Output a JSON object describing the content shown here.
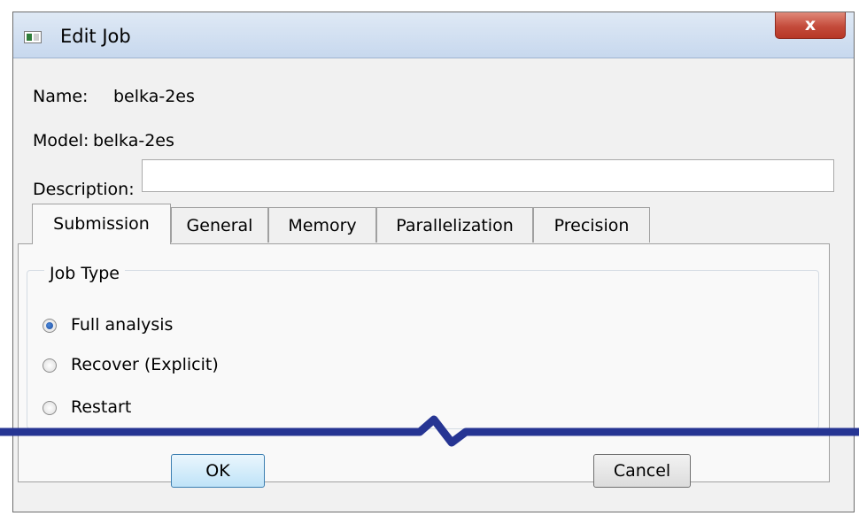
{
  "window": {
    "title": "Edit Job",
    "close_glyph": "x",
    "icon": "app-window-icon"
  },
  "fields": {
    "name_label": "Name:",
    "name_value": "belka-2es",
    "model_label": "Model:",
    "model_value": "belka-2es",
    "description_label": "Description:",
    "description_value": ""
  },
  "tabs": [
    {
      "label": "Submission",
      "active": true
    },
    {
      "label": "General"
    },
    {
      "label": "Memory"
    },
    {
      "label": "Parallelization"
    },
    {
      "label": "Precision"
    }
  ],
  "job_type": {
    "title": "Job Type",
    "options": [
      {
        "label": "Full analysis",
        "checked": true
      },
      {
        "label": "Recover (Explicit)",
        "checked": false
      },
      {
        "label": "Restart",
        "checked": false
      }
    ]
  },
  "buttons": {
    "ok": "OK",
    "cancel": "Cancel"
  },
  "colors": {
    "break_line": "#263593",
    "close_button": "#c44b3b"
  }
}
